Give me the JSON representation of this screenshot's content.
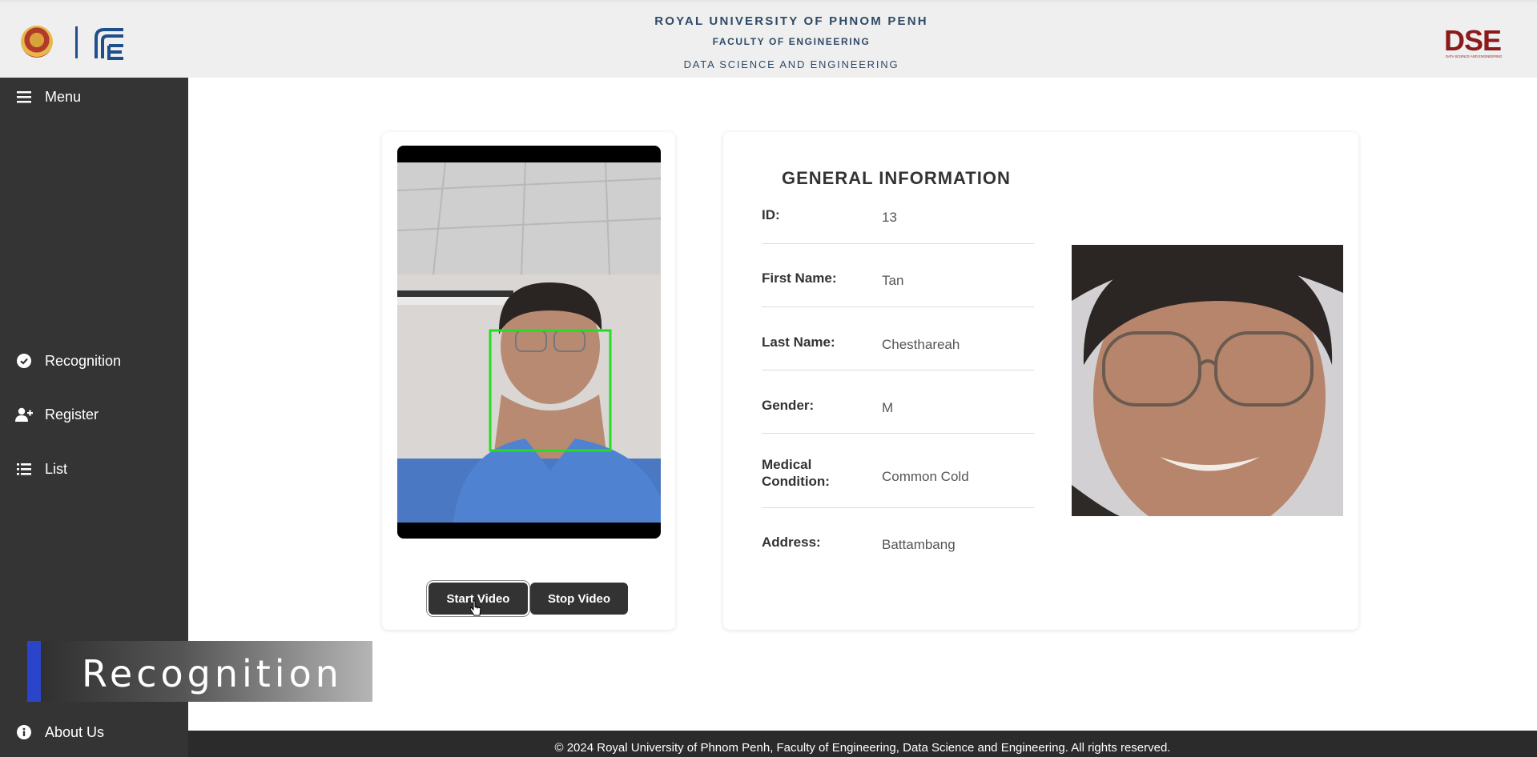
{
  "header": {
    "university": "ROYAL UNIVERSITY OF PHNOM PENH",
    "faculty": "FACULTY OF ENGINEERING",
    "department": "DATA SCIENCE AND ENGINEERING",
    "left_logo_icon": "university-seal-icon",
    "fe_logo_icon": "fe-logo-icon",
    "dse_logo": "DSE",
    "dse_logo_subtext": "DATA SCIENCE AND ENGINEERING"
  },
  "sidebar": {
    "menu_label": "Menu",
    "items": [
      {
        "label": "Recognition",
        "icon": "check-circle-icon"
      },
      {
        "label": "Register",
        "icon": "add-user-icon"
      },
      {
        "label": "List",
        "icon": "list-icon"
      },
      {
        "label": "About Us",
        "icon": "info-icon"
      }
    ]
  },
  "video": {
    "start_label": "Start Video",
    "stop_label": "Stop Video"
  },
  "info": {
    "title": "GENERAL INFORMATION",
    "fields": [
      {
        "label": "ID:",
        "value": "13"
      },
      {
        "label": "First Name:",
        "value": "Tan"
      },
      {
        "label": "Last Name:",
        "value": "Chesthareah"
      },
      {
        "label": "Gender:",
        "value": "M"
      },
      {
        "label": "Medical Condition:",
        "value": "Common Cold"
      },
      {
        "label": "Address:",
        "value": "Battambang"
      }
    ]
  },
  "caption": "Recognition",
  "footer": "© 2024 Royal University of Phnom Penh, Faculty of Engineering, Data Science and Engineering. All rights reserved.",
  "colors": {
    "header_bg": "#efefef",
    "sidebar_bg": "#343434",
    "header_text": "#2f4a66",
    "detection_box": "#22dd22",
    "caption_accent": "#2a45c9",
    "dse_logo": "#8b1a1a"
  }
}
